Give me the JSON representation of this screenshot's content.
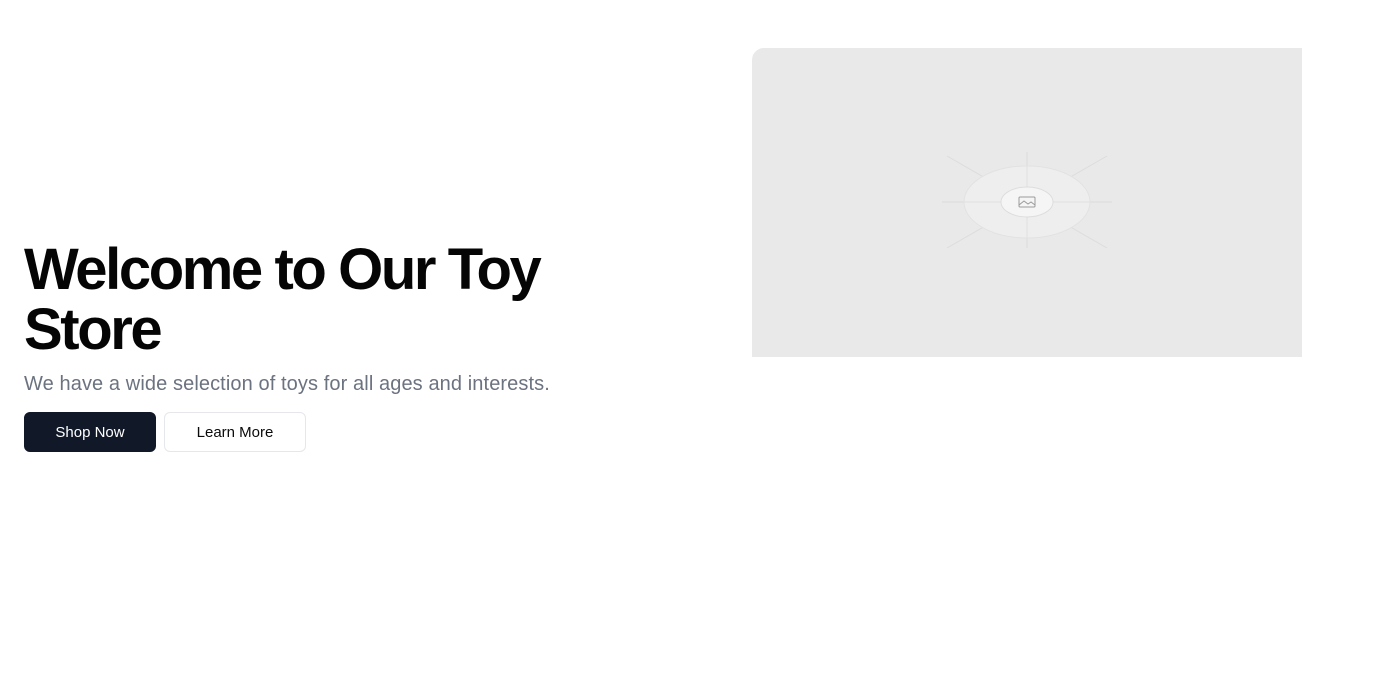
{
  "hero": {
    "title": "Welcome to Our Toy Store",
    "subtitle": "We have a wide selection of toys for all ages and interests.",
    "primary_button": "Shop Now",
    "secondary_button": "Learn More",
    "image": {
      "icon": "image-placeholder-icon"
    }
  },
  "colors": {
    "primary_button_bg": "#111827",
    "subtitle_text": "#6b7280",
    "image_placeholder_bg": "#e9e9e9"
  }
}
